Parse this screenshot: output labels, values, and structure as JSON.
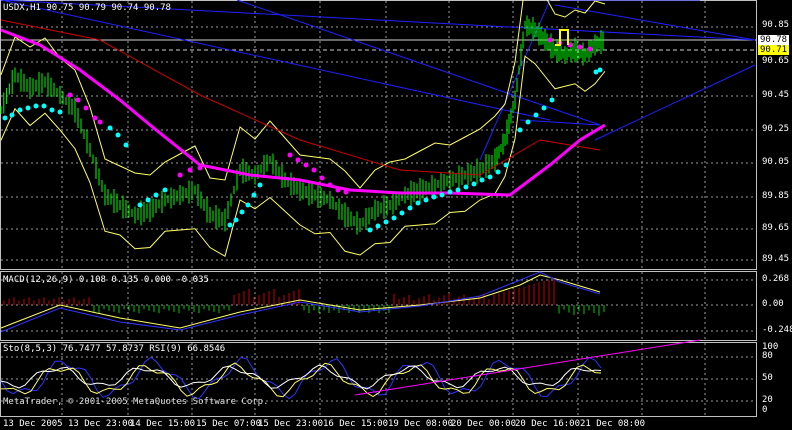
{
  "main": {
    "header": "USDX,H1  90.75 90.79 90.74 90.78",
    "price_labels": [
      "90.85",
      "90.65",
      "90.45",
      "90.25",
      "90.05",
      "89.85",
      "89.65",
      "89.45"
    ],
    "current_price": "90.78",
    "level_price": "90.71"
  },
  "macd": {
    "header": "MACD(12,26,9)  0.108 0.135 0.000 -0.035",
    "labels": [
      "0.268",
      "0.00",
      "-0.248"
    ]
  },
  "stoch": {
    "header": "Sto(8,5,3) 76.7477 57.8737  RSI(9) 66.8546",
    "labels": [
      "100",
      "80",
      "50",
      "20",
      "0"
    ]
  },
  "copyright": "MetaTrader, © 2001-2005 MetaQuotes Software Corp.",
  "time_labels": [
    "13 Dec 2005",
    "13 Dec 23:00",
    "14 Dec 15:00",
    "15 Dec 07:00",
    "15 Dec 23:00",
    "16 Dec 15:00",
    "19 Dec 08:00",
    "20 Dec 00:00",
    "20 Dec 16:00",
    "21 Dec 08:00"
  ],
  "colors": {
    "background": "#000000",
    "candles": "#00ff00",
    "ma_magenta": "#ff00ff",
    "psar_cyan": "#00ffff",
    "bollinger": "#ffff66",
    "ma_red": "#cc0000",
    "trend_blue": "#2020ff",
    "grid": "#c0c0c0"
  }
}
